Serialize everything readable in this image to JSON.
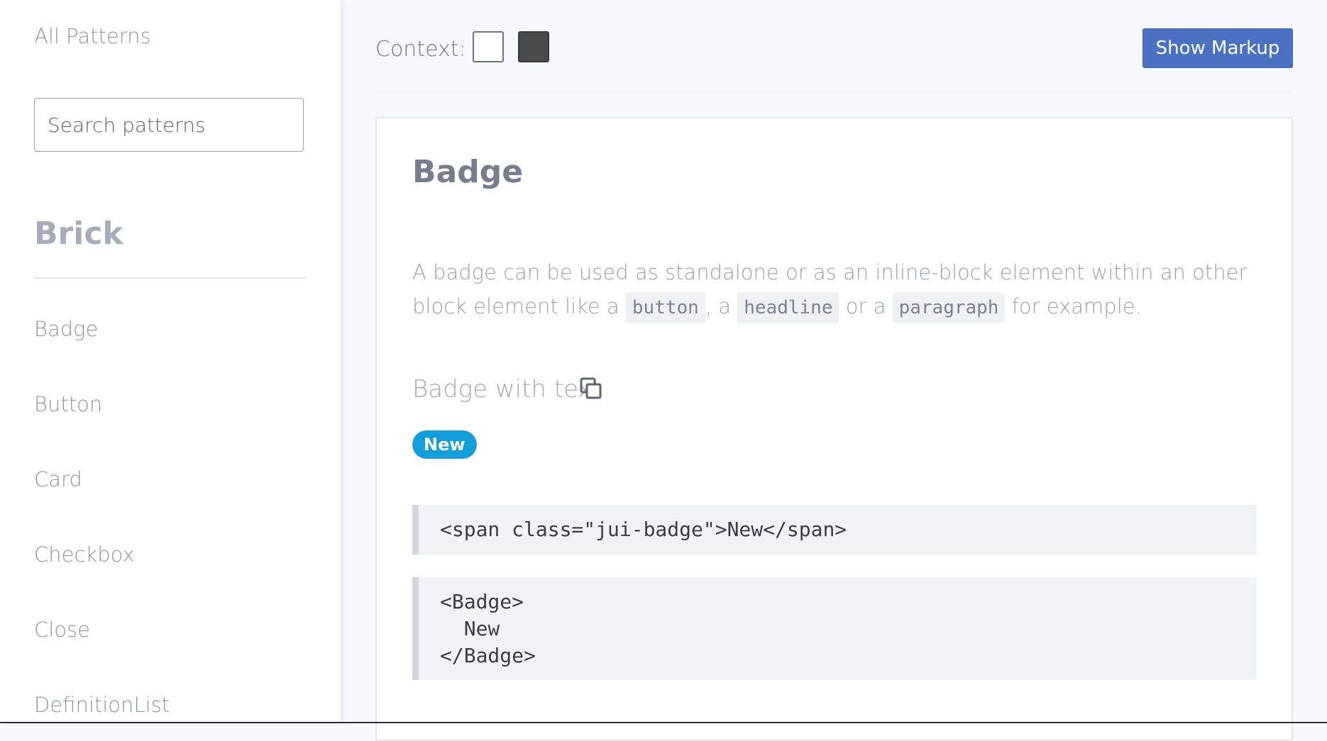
{
  "sidebar": {
    "all_patterns": "All Patterns",
    "search_placeholder": "Search patterns",
    "section_title": "Brick",
    "items": [
      {
        "label": "Badge"
      },
      {
        "label": "Button"
      },
      {
        "label": "Card"
      },
      {
        "label": "Checkbox"
      },
      {
        "label": "Close"
      },
      {
        "label": "DefinitionList"
      }
    ]
  },
  "toolbar": {
    "context_label": "Context:",
    "swatches": [
      "#ffffff",
      "#4a4a4a"
    ],
    "show_markup_label": "Show Markup"
  },
  "content": {
    "title": "Badge",
    "description": {
      "part1": "A badge can be used as standalone or as an inline-block element within an other block element like a ",
      "code1": "button",
      "part2": ", a ",
      "code2": "headline",
      "part3": " or a ",
      "code3": "paragraph",
      "part4": " for example."
    },
    "variant_title": "Badge with text",
    "copy_icon": "copy-icon",
    "badge_label": "New",
    "badge_color": "#149fdb",
    "code_html": "<span class=\"jui-badge\">New</span>",
    "code_jsx": "<Badge>\n  New\n</Badge>"
  }
}
